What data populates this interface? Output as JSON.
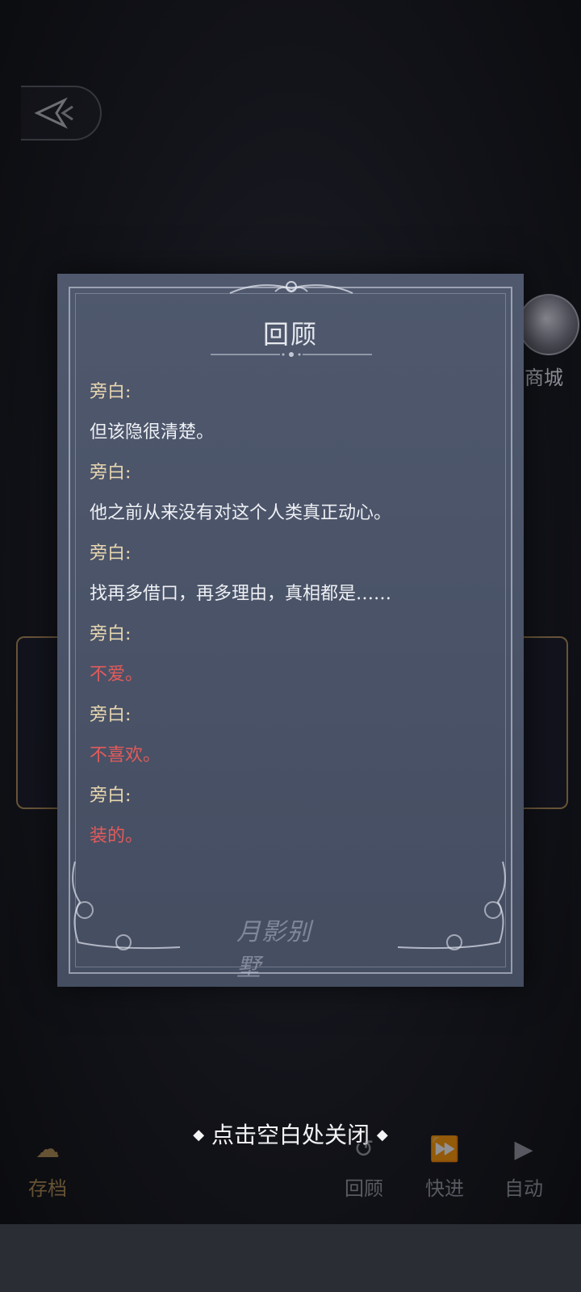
{
  "review": {
    "title": "回顾",
    "entries": [
      {
        "speaker": "旁白:",
        "text": "但该隐很清楚。"
      },
      {
        "speaker": "旁白:",
        "text": "他之前从来没有对这个人类真正动心。"
      },
      {
        "speaker": "旁白:",
        "text": "找再多借口，再多理由，真相都是……"
      },
      {
        "speaker": "旁白:",
        "text": "不爱。",
        "highlight": true
      },
      {
        "speaker": "旁白:",
        "text": "不喜欢。",
        "highlight": true
      },
      {
        "speaker": "旁白:",
        "text": "装的。",
        "highlight": true
      }
    ],
    "watermark": "月影别墅"
  },
  "close_hint": "点击空白处关闭",
  "side": {
    "shop_label": "商城"
  },
  "toolbar": {
    "save_label": "存档",
    "review_label": "回顾",
    "fast_forward_label": "快进",
    "auto_label": "自动"
  },
  "colors": {
    "panel_bg": "#4b5468",
    "speaker": "#e8d7b0",
    "dialogue": "#eef0f4",
    "highlight": "#e35b5b"
  },
  "icons": {
    "back": "back-arrow-icon",
    "save": "cloud-save-icon",
    "review": "review-icon",
    "fast_forward": "fast-forward-icon",
    "auto": "play-icon"
  }
}
